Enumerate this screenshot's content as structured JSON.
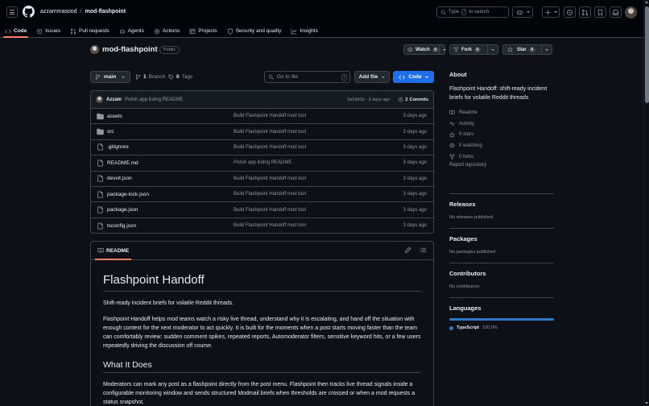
{
  "header": {
    "owner": "azzammasood",
    "separator": "/",
    "repo": "mod-flashpoint",
    "search_prefix": "Type",
    "search_key": "/",
    "search_suffix": "to search"
  },
  "tabs": [
    {
      "label": "Code",
      "icon": "code-icon"
    },
    {
      "label": "Issues",
      "icon": "issue-icon"
    },
    {
      "label": "Pull requests",
      "icon": "pull-request-icon"
    },
    {
      "label": "Agents",
      "icon": "agent-icon"
    },
    {
      "label": "Actions",
      "icon": "play-icon"
    },
    {
      "label": "Projects",
      "icon": "table-icon"
    },
    {
      "label": "Security and quality",
      "icon": "shield-icon"
    },
    {
      "label": "Insights",
      "icon": "graph-icon"
    }
  ],
  "repo": {
    "name": "mod-flashpoint",
    "visibility": "Public",
    "watch_label": "Watch",
    "watch_count": "0",
    "fork_label": "Fork",
    "fork_count": "0",
    "star_label": "Star",
    "star_count": "0"
  },
  "toolbar": {
    "branch": "main",
    "branch_count": "1",
    "branch_label": "Branch",
    "tag_count": "0",
    "tag_label": "Tags",
    "goto_placeholder": "Go to file",
    "goto_key": "t",
    "add_file": "Add file",
    "code_button": "Code"
  },
  "latest_commit": {
    "author": "Azzam",
    "message": "Polish app listing README",
    "hash_time": "3a10d1b · 3 days ago",
    "commits_count": "2",
    "commits_label": "Commits"
  },
  "files": [
    {
      "name": "assets",
      "type": "folder",
      "message": "Build Flashpoint Handoff mod tool",
      "date": "3 days ago"
    },
    {
      "name": "src",
      "type": "folder",
      "message": "Build Flashpoint Handoff mod tool",
      "date": "3 days ago"
    },
    {
      "name": ".gitignore",
      "type": "file",
      "message": "Build Flashpoint Handoff mod tool",
      "date": "3 days ago"
    },
    {
      "name": "README.md",
      "type": "file",
      "message": "Polish app listing README",
      "date": "3 days ago"
    },
    {
      "name": "devvit.json",
      "type": "file",
      "message": "Build Flashpoint Handoff mod tool",
      "date": "3 days ago"
    },
    {
      "name": "package-lock.json",
      "type": "file",
      "message": "Build Flashpoint Handoff mod tool",
      "date": "3 days ago"
    },
    {
      "name": "package.json",
      "type": "file",
      "message": "Build Flashpoint Handoff mod tool",
      "date": "3 days ago"
    },
    {
      "name": "tsconfig.json",
      "type": "file",
      "message": "Build Flashpoint Handoff mod tool",
      "date": "3 days ago"
    }
  ],
  "readme": {
    "tab_label": "README",
    "title": "Flashpoint Handoff",
    "tagline": "Shift-ready incident briefs for volatile Reddit threads.",
    "paragraph1": "Flashpoint Handoff helps mod teams watch a risky live thread, understand why it is escalating, and hand off the situation with enough context for the next moderator to act quickly. It is built for the moments when a post starts moving faster than the team can comfortably review: sudden comment spikes, repeated reports, Automoderator filters, sensitive keyword hits, or a few users repeatedly driving the discussion off course.",
    "heading2": "What It Does",
    "paragraph2": "Moderators can mark any post as a flashpoint directly from the post menu. Flashpoint then tracks live thread signals inside a configurable monitoring window and sends structured Modmail briefs when thresholds are crossed or when a mod requests a status snapshot."
  },
  "sidebar": {
    "about_title": "About",
    "about_desc": "Flashpoint Handoff: shift-ready incident briefs for volatile Reddit threads",
    "items": [
      {
        "label": "Readme",
        "icon": "book-icon"
      },
      {
        "label": "Activity",
        "icon": "pulse-icon"
      },
      {
        "label": "0 stars",
        "icon": "star-icon"
      },
      {
        "label": "0 watching",
        "icon": "eye-icon"
      },
      {
        "label": "0 forks",
        "icon": "fork-icon"
      }
    ],
    "report": "Report repository",
    "releases_title": "Releases",
    "releases_text": "No releases published",
    "packages_title": "Packages",
    "packages_text": "No packages published",
    "contributors_title": "Contributors",
    "contributors_text": "No contributors",
    "languages_title": "Languages",
    "language_name": "TypeScript",
    "language_pct": "100.0%",
    "language_share": 1.0
  },
  "colors": {
    "accent": "#1f6feb",
    "underline": "#f78166",
    "typescript": "#3178c6",
    "background": "#0d1117"
  }
}
